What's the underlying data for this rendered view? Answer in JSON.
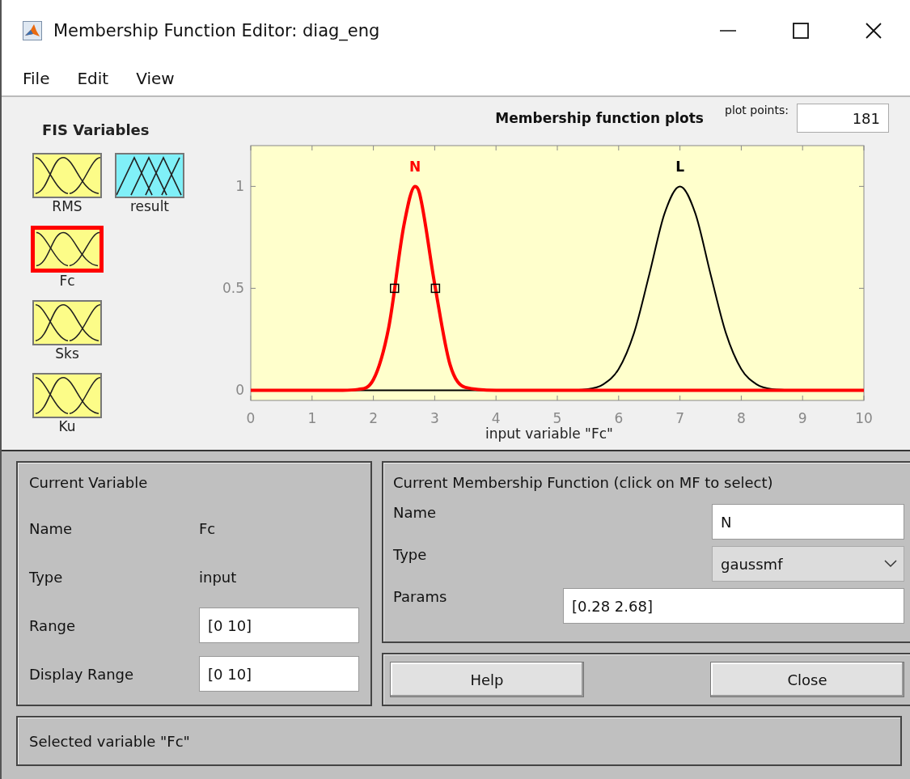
{
  "window": {
    "title": "Membership Function Editor: diag_eng"
  },
  "menu": [
    "File",
    "Edit",
    "View"
  ],
  "fis_variables": {
    "title": "FIS Variables",
    "items": [
      {
        "name": "RMS",
        "kind": "input",
        "selected": false
      },
      {
        "name": "result",
        "kind": "output",
        "selected": false
      },
      {
        "name": "Fc",
        "kind": "input",
        "selected": true
      },
      {
        "name": "Sks",
        "kind": "input",
        "selected": false
      },
      {
        "name": "Ku",
        "kind": "input",
        "selected": false
      }
    ]
  },
  "plot": {
    "plot_points_label": "plot points:",
    "plot_points": "181",
    "chart_data": {
      "type": "line",
      "title": "Membership function plots",
      "xlabel": "input variable \"Fc\"",
      "xlim": [
        0,
        10
      ],
      "ylim": [
        -0.05,
        1.2
      ],
      "xticks": [
        0,
        1,
        2,
        3,
        4,
        5,
        6,
        7,
        8,
        9,
        10
      ],
      "yticks": [
        0,
        0.5,
        1
      ],
      "x": [
        0,
        0.5,
        1,
        1.5,
        1.75,
        2,
        2.25,
        2.5,
        2.68,
        2.75,
        3,
        3.25,
        3.5,
        4,
        4.5,
        5,
        5.5,
        5.75,
        6,
        6.25,
        6.5,
        6.75,
        7,
        7.25,
        7.5,
        7.75,
        8,
        8.25,
        8.5,
        9,
        9.5,
        10
      ],
      "series": [
        {
          "name": "N",
          "color": "#ff0000",
          "values": [
            0,
            0,
            0,
            0,
            0.004,
            0.052,
            0.308,
            0.813,
            1,
            0.969,
            0.52,
            0.126,
            0.014,
            0,
            0,
            0,
            0,
            0,
            0,
            0,
            0,
            0,
            0,
            0,
            0,
            0,
            0,
            0,
            0,
            0,
            0,
            0
          ]
        },
        {
          "name": "L",
          "color": "#000000",
          "values": [
            null,
            null,
            null,
            0,
            0,
            0,
            0,
            0,
            0,
            0,
            0,
            0,
            0,
            0,
            0,
            0,
            0.006,
            0.029,
            0.104,
            0.28,
            0.568,
            0.868,
            1,
            0.868,
            0.568,
            0.28,
            0.104,
            0.029,
            0.006,
            0,
            null,
            null
          ]
        }
      ]
    },
    "curves": [
      {
        "selected": true
      },
      {
        "selected": false
      }
    ]
  },
  "current_variable": {
    "title": "Current Variable",
    "rows": [
      {
        "label": "Name",
        "value": "Fc",
        "kind": "text"
      },
      {
        "label": "Type",
        "value": "input",
        "kind": "text"
      },
      {
        "label": "Range",
        "value": "[0 10]",
        "kind": "input"
      },
      {
        "label": "Display Range",
        "value": "[0 10]",
        "kind": "input"
      }
    ]
  },
  "current_mf": {
    "title": "Current Membership Function (click on MF to select)",
    "name_label": "Name",
    "name": "N",
    "type_label": "Type",
    "type": "gaussmf",
    "params_label": "Params",
    "params": "[0.28 2.68]"
  },
  "buttons": [
    "Help",
    "Close"
  ],
  "status": "Selected variable \"Fc\""
}
